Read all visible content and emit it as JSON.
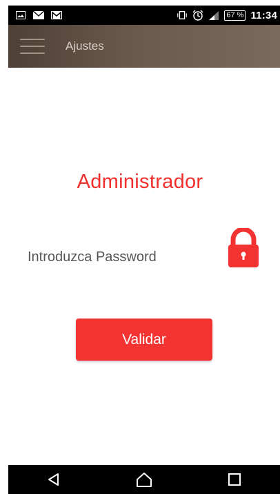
{
  "status_bar": {
    "icons_left": [
      "image-icon",
      "email-icon",
      "gmail-icon"
    ],
    "icons_right": [
      "vibrate-icon",
      "alarm-icon",
      "signal-icon"
    ],
    "battery": "67 %",
    "time": "11:34"
  },
  "app_bar": {
    "title": "Ajustes"
  },
  "main": {
    "heading": "Administrador",
    "prompt": "Introduzca Password",
    "validate_label": "Validar"
  },
  "colors": {
    "accent": "#f23331",
    "heading": "#f0302e",
    "app_bar": "#6a584a"
  }
}
